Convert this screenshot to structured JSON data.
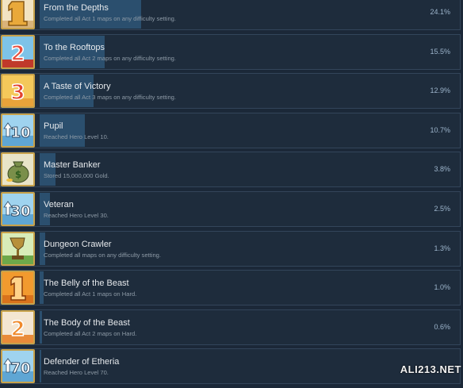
{
  "achievements": [
    {
      "icon": "gold-numeral-1-icon",
      "title": "From the Depths",
      "description": "Completed all Act 1 maps on any difficulty setting.",
      "unlock_percent": "24.1%",
      "progress_fraction": 0.241
    },
    {
      "icon": "red-numeral-2-icon",
      "title": "To the Rooftops",
      "description": "Completed all Act 2 maps on any difficulty setting.",
      "unlock_percent": "15.5%",
      "progress_fraction": 0.155
    },
    {
      "icon": "red-numeral-3-icon",
      "title": "A Taste of Victory",
      "description": "Completed all Act 3 maps on any difficulty setting.",
      "unlock_percent": "12.9%",
      "progress_fraction": 0.129
    },
    {
      "icon": "level-10-arrow-icon",
      "title": "Pupil",
      "description": "Reached Hero Level 10.",
      "unlock_percent": "10.7%",
      "progress_fraction": 0.107
    },
    {
      "icon": "money-bag-icon",
      "title": "Master Banker",
      "description": "Stored 15,000,000 Gold.",
      "unlock_percent": "3.8%",
      "progress_fraction": 0.038
    },
    {
      "icon": "level-30-arrow-icon",
      "title": "Veteran",
      "description": "Reached Hero Level 30.",
      "unlock_percent": "2.5%",
      "progress_fraction": 0.025
    },
    {
      "icon": "trophy-icon",
      "title": "Dungeon Crawler",
      "description": "Completed all maps on any difficulty setting.",
      "unlock_percent": "1.3%",
      "progress_fraction": 0.013
    },
    {
      "icon": "orange-numeral-1-icon",
      "title": "The Belly of the Beast",
      "description": "Completed all Act 1 maps on Hard.",
      "unlock_percent": "1.0%",
      "progress_fraction": 0.01
    },
    {
      "icon": "orange-numeral-2-icon",
      "title": "The Body of the Beast",
      "description": "Completed all Act 2 maps on Hard.",
      "unlock_percent": "0.6%",
      "progress_fraction": 0.006
    },
    {
      "icon": "level-70-arrow-icon",
      "title": "Defender of Etheria",
      "description": "Reached Hero Level 70.",
      "unlock_percent": "",
      "progress_fraction": 0.002
    }
  ],
  "watermark": "ALI213.NET",
  "colors": {
    "background": "#1b2838",
    "row": "#1e2c3c",
    "progress_bar": "#2b4f6e",
    "title_text": "#e6e9ec",
    "description_text": "#8d9aa6",
    "percent_text": "#9db5cc"
  }
}
